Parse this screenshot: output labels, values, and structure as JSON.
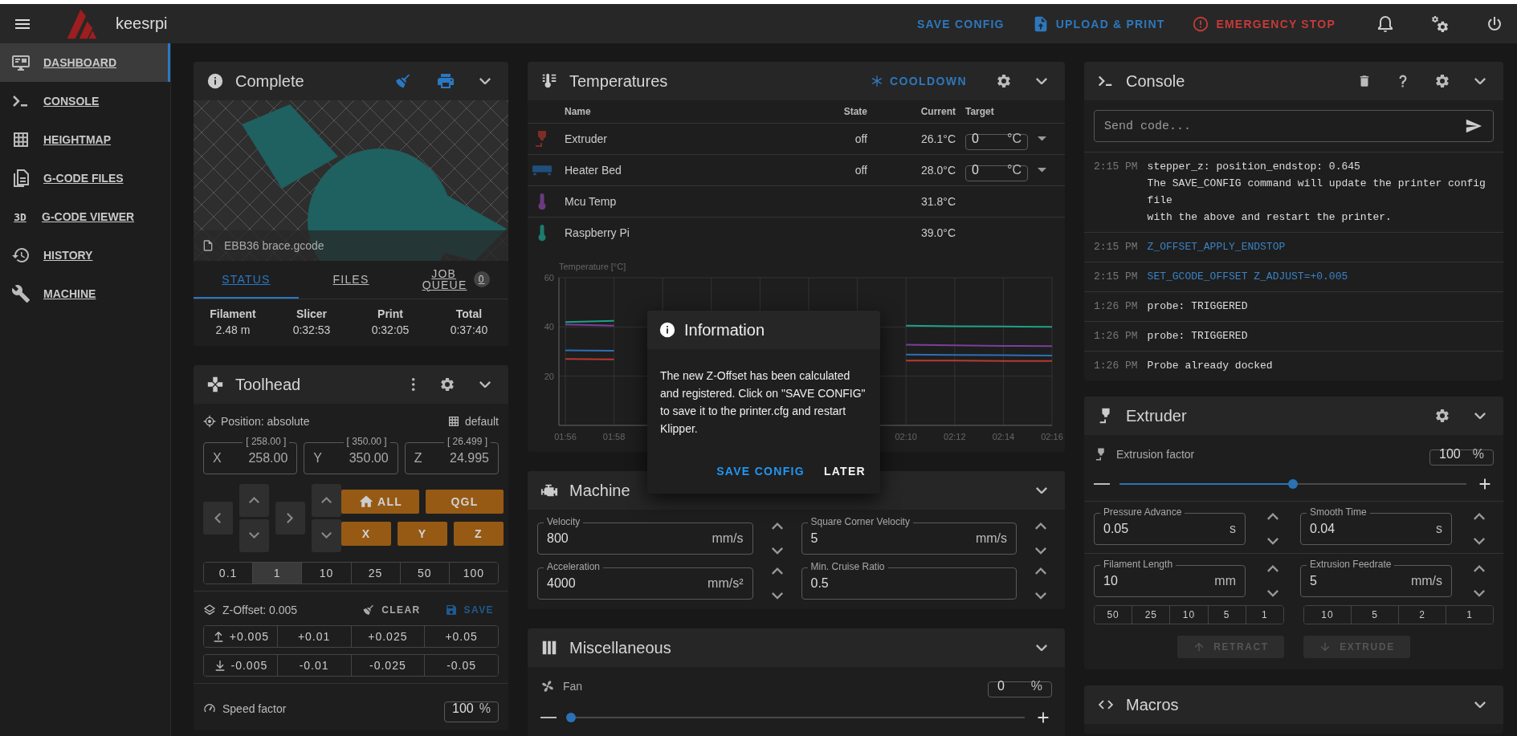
{
  "app_bar": {
    "title": "keesrpi",
    "actions": [
      {
        "kind": "text",
        "label": "SAVE CONFIG"
      },
      {
        "kind": "upload",
        "label": "UPLOAD & PRINT"
      },
      {
        "kind": "stop",
        "label": "EMERGENCY STOP"
      }
    ]
  },
  "sidebar": {
    "items": [
      {
        "label": "DASHBOARD",
        "selected": true
      },
      {
        "label": "CONSOLE",
        "selected": false
      },
      {
        "label": "HEIGHTMAP",
        "selected": false
      },
      {
        "label": "G-CODE FILES",
        "selected": false
      },
      {
        "label": "G-CODE VIEWER",
        "selected": false,
        "icon_text": "3D"
      },
      {
        "label": "HISTORY",
        "selected": false
      },
      {
        "label": "MACHINE",
        "selected": false
      }
    ]
  },
  "status": {
    "title": "Complete",
    "file": "EBB36 brace.gcode",
    "tabs": [
      {
        "label": "STATUS",
        "selected": true
      },
      {
        "label": "FILES",
        "selected": false
      },
      {
        "label": "JOB QUEUE",
        "selected": false,
        "badge": "0"
      }
    ],
    "stats": [
      {
        "label": "Filament",
        "value": "2.48 m"
      },
      {
        "label": "Slicer",
        "value": "0:32:53"
      },
      {
        "label": "Print",
        "value": "0:32:05"
      },
      {
        "label": "Total",
        "value": "0:37:40"
      }
    ]
  },
  "toolhead": {
    "title": "Toolhead",
    "position_mode": "Position: absolute",
    "mesh": "default",
    "axes": [
      {
        "axis": "X",
        "target": "[ 258.00 ]",
        "value": "258.00"
      },
      {
        "axis": "Y",
        "target": "[ 350.00 ]",
        "value": "350.00"
      },
      {
        "axis": "Z",
        "target": "[ 26.499 ]",
        "value": "24.995"
      }
    ],
    "home_buttons": [
      {
        "kind": "home",
        "label": "ALL"
      },
      {
        "kind": "plain",
        "label": "QGL"
      },
      {
        "kind": "plain",
        "label": "X"
      },
      {
        "kind": "plain",
        "label": "Y"
      },
      {
        "kind": "plain",
        "label": "Z"
      }
    ],
    "steps": [
      {
        "label": "0.1",
        "selected": false
      },
      {
        "label": "1",
        "selected": true
      },
      {
        "label": "10",
        "selected": false
      },
      {
        "label": "25",
        "selected": false
      },
      {
        "label": "50",
        "selected": false
      },
      {
        "label": "100",
        "selected": false
      }
    ],
    "z_offset": {
      "label": "Z-Offset: 0.005",
      "clear": "CLEAR",
      "save": "SAVE",
      "up": [
        "+0.005",
        "+0.01",
        "+0.025",
        "+0.05"
      ],
      "down": [
        "-0.005",
        "-0.01",
        "-0.025",
        "-0.05"
      ]
    },
    "speed": {
      "label": "Speed factor",
      "value": "100",
      "unit": "%"
    }
  },
  "temperatures": {
    "title": "Temperatures",
    "cooldown": "COOLDOWN",
    "columns": [
      "Name",
      "State",
      "Current",
      "Target"
    ],
    "rows": [
      {
        "kind": "extruder",
        "name": "Extruder",
        "state": "off",
        "current": "26.1°C",
        "target": "0",
        "unit": "°C",
        "color": "#7b2d26"
      },
      {
        "kind": "bed",
        "name": "Heater Bed",
        "state": "off",
        "current": "28.0°C",
        "target": "0",
        "unit": "°C",
        "color": "#1f4f7c"
      },
      {
        "kind": "sensor",
        "name": "Mcu Temp",
        "current": "31.8°C",
        "color": "#6a3a80"
      },
      {
        "kind": "sensor",
        "name": "Raspberry Pi",
        "current": "39.0°C",
        "color": "#1d7a6c"
      }
    ],
    "chart_data": {
      "type": "line",
      "ylabel": "Temperature [°C]",
      "categories": [
        "01:56",
        "01:58",
        null,
        null,
        null,
        null,
        null,
        "02:10",
        "02:12",
        "02:14",
        "02:16"
      ],
      "ylim": [
        0,
        60
      ],
      "yticks": [
        20,
        40,
        60
      ],
      "grid": true,
      "series": [
        {
          "color": "#b83a30",
          "values": [
            27,
            26.8,
            null,
            null,
            null,
            null,
            null,
            26.3,
            26.3,
            26.2,
            26.2
          ]
        },
        {
          "color": "#2d6fb5",
          "values": [
            30.5,
            30.3,
            null,
            null,
            null,
            null,
            null,
            28.8,
            28.6,
            28.5,
            28.4
          ]
        },
        {
          "color": "#7b3f9a",
          "values": [
            41,
            40.5,
            null,
            null,
            null,
            null,
            null,
            32.8,
            32.5,
            32.3,
            32.2
          ]
        },
        {
          "color": "#1fa08a",
          "values": [
            42,
            42.5,
            null,
            null,
            null,
            null,
            null,
            40.5,
            40.3,
            40.2,
            40
          ]
        }
      ]
    }
  },
  "dialog": {
    "title": "Information",
    "message": "The new Z-Offset has been calculated and registered. Click on \"SAVE CONFIG\" to save it to the printer.cfg and restart Klipper.",
    "buttons": [
      {
        "kind": "primary",
        "label": "SAVE CONFIG"
      },
      {
        "kind": "plain",
        "label": "LATER"
      }
    ]
  },
  "machine": {
    "title": "Machine",
    "fields": [
      {
        "label": "Velocity",
        "value": "800",
        "unit": "mm/s"
      },
      {
        "label": "Square Corner Velocity",
        "value": "5",
        "unit": "mm/s"
      },
      {
        "label": "Acceleration",
        "value": "4000",
        "unit": "mm/s²"
      },
      {
        "label": "Min. Cruise Ratio",
        "value": "0.5"
      }
    ]
  },
  "misc": {
    "title": "Miscellaneous",
    "fan": {
      "label": "Fan",
      "value": "0",
      "unit": "%",
      "level": 0
    }
  },
  "console": {
    "title": "Console",
    "placeholder": "Send code...",
    "entries": [
      {
        "time": "2:15 PM",
        "kind": "response",
        "lines": [
          "stepper_z: position_endstop: 0.645",
          "The SAVE_CONFIG command will update the printer config file",
          "with the above and restart the printer."
        ]
      },
      {
        "time": "2:15 PM",
        "kind": "command",
        "lines": [
          "Z_OFFSET_APPLY_ENDSTOP"
        ]
      },
      {
        "time": "2:15 PM",
        "kind": "command",
        "lines": [
          "SET_GCODE_OFFSET Z_ADJUST=+0.005"
        ]
      },
      {
        "time": "1:26 PM",
        "kind": "response",
        "lines": [
          "probe: TRIGGERED"
        ]
      },
      {
        "time": "1:26 PM",
        "kind": "response",
        "lines": [
          "probe: TRIGGERED"
        ]
      },
      {
        "time": "1:26 PM",
        "kind": "response",
        "lines": [
          "Probe already docked"
        ]
      }
    ]
  },
  "extruder": {
    "title": "Extruder",
    "factor": {
      "label": "Extrusion factor",
      "value": "100",
      "unit": "%",
      "level": 0.5
    },
    "fields": [
      {
        "label": "Pressure Advance",
        "value": "0.05",
        "unit": "s"
      },
      {
        "label": "Smooth Time",
        "value": "0.04",
        "unit": "s"
      },
      {
        "label": "Filament Length",
        "value": "10",
        "unit": "mm"
      },
      {
        "label": "Extrusion Feedrate",
        "value": "5",
        "unit": "mm/s"
      }
    ],
    "length_steps": [
      "50",
      "25",
      "10",
      "5",
      "1"
    ],
    "feedrate_steps": [
      "10",
      "5",
      "2",
      "1"
    ],
    "buttons": [
      {
        "kind": "retract",
        "label": "RETRACT",
        "disabled": true
      },
      {
        "kind": "extrude",
        "label": "EXTRUDE",
        "disabled": true
      }
    ]
  },
  "macros": {
    "title": "Macros"
  }
}
